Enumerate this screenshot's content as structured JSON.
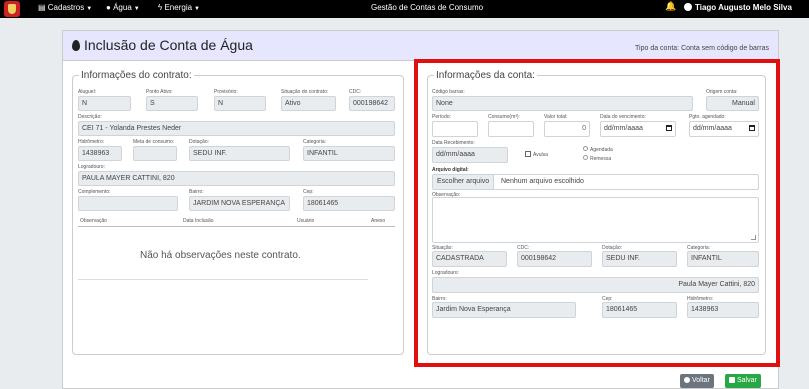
{
  "topbar": {
    "menu_cadastros": "Cadastros",
    "menu_agua": "Água",
    "menu_energia": "Energia",
    "title": "Gestão de Contas de Consumo",
    "user": "Tiago Augusto Melo Silva"
  },
  "panel": {
    "title": "Inclusão de Conta de Água",
    "tipo_conta": "Tipo da conta: Conta sem código de barras"
  },
  "contrato": {
    "legend": "Informações do contrato:",
    "aluguel_label": "Aluguel:",
    "aluguel": "N",
    "ponto_ativo_label": "Ponto Ativo:",
    "ponto_ativo": "S",
    "provisorio_label": "Provisório:",
    "provisorio": "N",
    "situacao_label": "Situação do contrato:",
    "situacao": "Ativo",
    "cdc_label": "CDC:",
    "cdc": "000198642",
    "descricao_label": "Descrição:",
    "descricao": "CEI 71 - Yolanda Prestes Neder",
    "hidrometro_label": "Hidrômetro:",
    "hidrometro": "1438963",
    "meta_label": "Meta de consumo:",
    "meta": "",
    "dotacao_label": "Dotação:",
    "dotacao": "SEDU INF.",
    "categoria_label": "Categoria:",
    "categoria": "INFANTIL",
    "logradouro_label": "Logradouro:",
    "logradouro": "PAULA MAYER CATTINI, 820",
    "complemento_label": "Complemento:",
    "complemento": "",
    "bairro_label": "Bairro:",
    "bairro": "JARDIM NOVA ESPERANÇA",
    "cep_label": "Cep:",
    "cep": "18061465",
    "obs_headers": [
      "Observação",
      "Data Inclusão",
      "Usuário",
      "Anexo"
    ],
    "empty_msg": "Não há observações neste contrato."
  },
  "conta": {
    "legend": "Informações da conta:",
    "codigo_barras_label": "Código barras:",
    "codigo_barras": "None",
    "origem_label": "Origem conta:",
    "origem": "Manual",
    "periodo_label": "Período:",
    "periodo": "",
    "consumo_label": "Consumo(m³):",
    "consumo": "",
    "valor_label": "Valor total:",
    "valor": "0",
    "vencimento_label": "Data do vencimento:",
    "vencimento_placeholder": "dd/mm/aaaa",
    "agendado_label": "Pgto. agendado:",
    "agendado_placeholder": "dd/mm/aaaa",
    "recebimento_label": "Data Recebimento:",
    "recebimento_placeholder": "dd/mm/aaaa",
    "avulsa_label": "Avulsa",
    "radio_agendada": "Agendada",
    "radio_remessa": "Remessa",
    "arquivo_label": "Arquivo digital:",
    "arquivo_btn": "Escolher arquivo",
    "arquivo_status": "Nenhum arquivo escolhido",
    "observacao_label": "Observação:",
    "situacao_label": "Situação:",
    "situacao": "CADASTRADA",
    "cdc_label": "CDC:",
    "cdc": "000198642",
    "dotacao_label": "Dotação:",
    "dotacao": "SEDU INF.",
    "categoria_label": "Categoria:",
    "categoria": "INFANTIL",
    "logradouro_label": "Logradouro:",
    "logradouro": "Paula Mayer Cattini, 820",
    "bairro_label": "Bairro:",
    "bairro": "Jardim Nova Esperança",
    "cep_label": "Cep:",
    "cep": "18061465",
    "hidrometro_label": "Hidrômetro:",
    "hidrometro": "1438963"
  },
  "actions": {
    "voltar": "Voltar",
    "salvar": "Salvar"
  }
}
